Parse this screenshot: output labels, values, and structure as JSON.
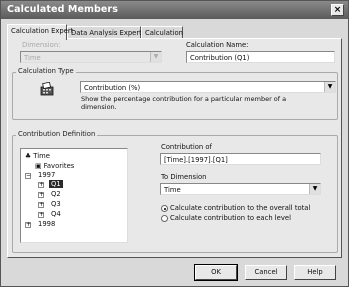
{
  "window": {
    "title": "Calculated Members"
  },
  "tabs": [
    {
      "label": "Calculation Expert"
    },
    {
      "label": "Data Analysis Expert"
    },
    {
      "label": "Calculation"
    }
  ],
  "dimension": {
    "label": "Dimension:",
    "value": "Time"
  },
  "calculation_name": {
    "label": "Calculation Name:",
    "value": "Contribution (Q1)"
  },
  "calculation_type": {
    "group_label": "Calculation Type",
    "selected": "Contribution (%)",
    "description": "Show the percentage contribution for a particular member of a dimension."
  },
  "contribution_definition": {
    "group_label": "Contribution Definition",
    "tree": [
      {
        "label": "Time"
      },
      {
        "label": "Favorites"
      },
      {
        "label": "1997"
      },
      {
        "label": "Q1"
      },
      {
        "label": "Q2"
      },
      {
        "label": "Q3"
      },
      {
        "label": "Q4"
      },
      {
        "label": "1998"
      }
    ],
    "contribution_of": {
      "label": "Contribution of",
      "value": "[Time].[1997].[Q1]"
    },
    "to_dimension": {
      "label": "To Dimension",
      "value": "Time"
    },
    "options": [
      {
        "label": "Calculate contribution to the overall total",
        "checked": true
      },
      {
        "label": "Calculate contribution to each level",
        "checked": false
      }
    ]
  },
  "buttons": {
    "ok": "OK",
    "cancel": "Cancel",
    "help": "Help"
  }
}
